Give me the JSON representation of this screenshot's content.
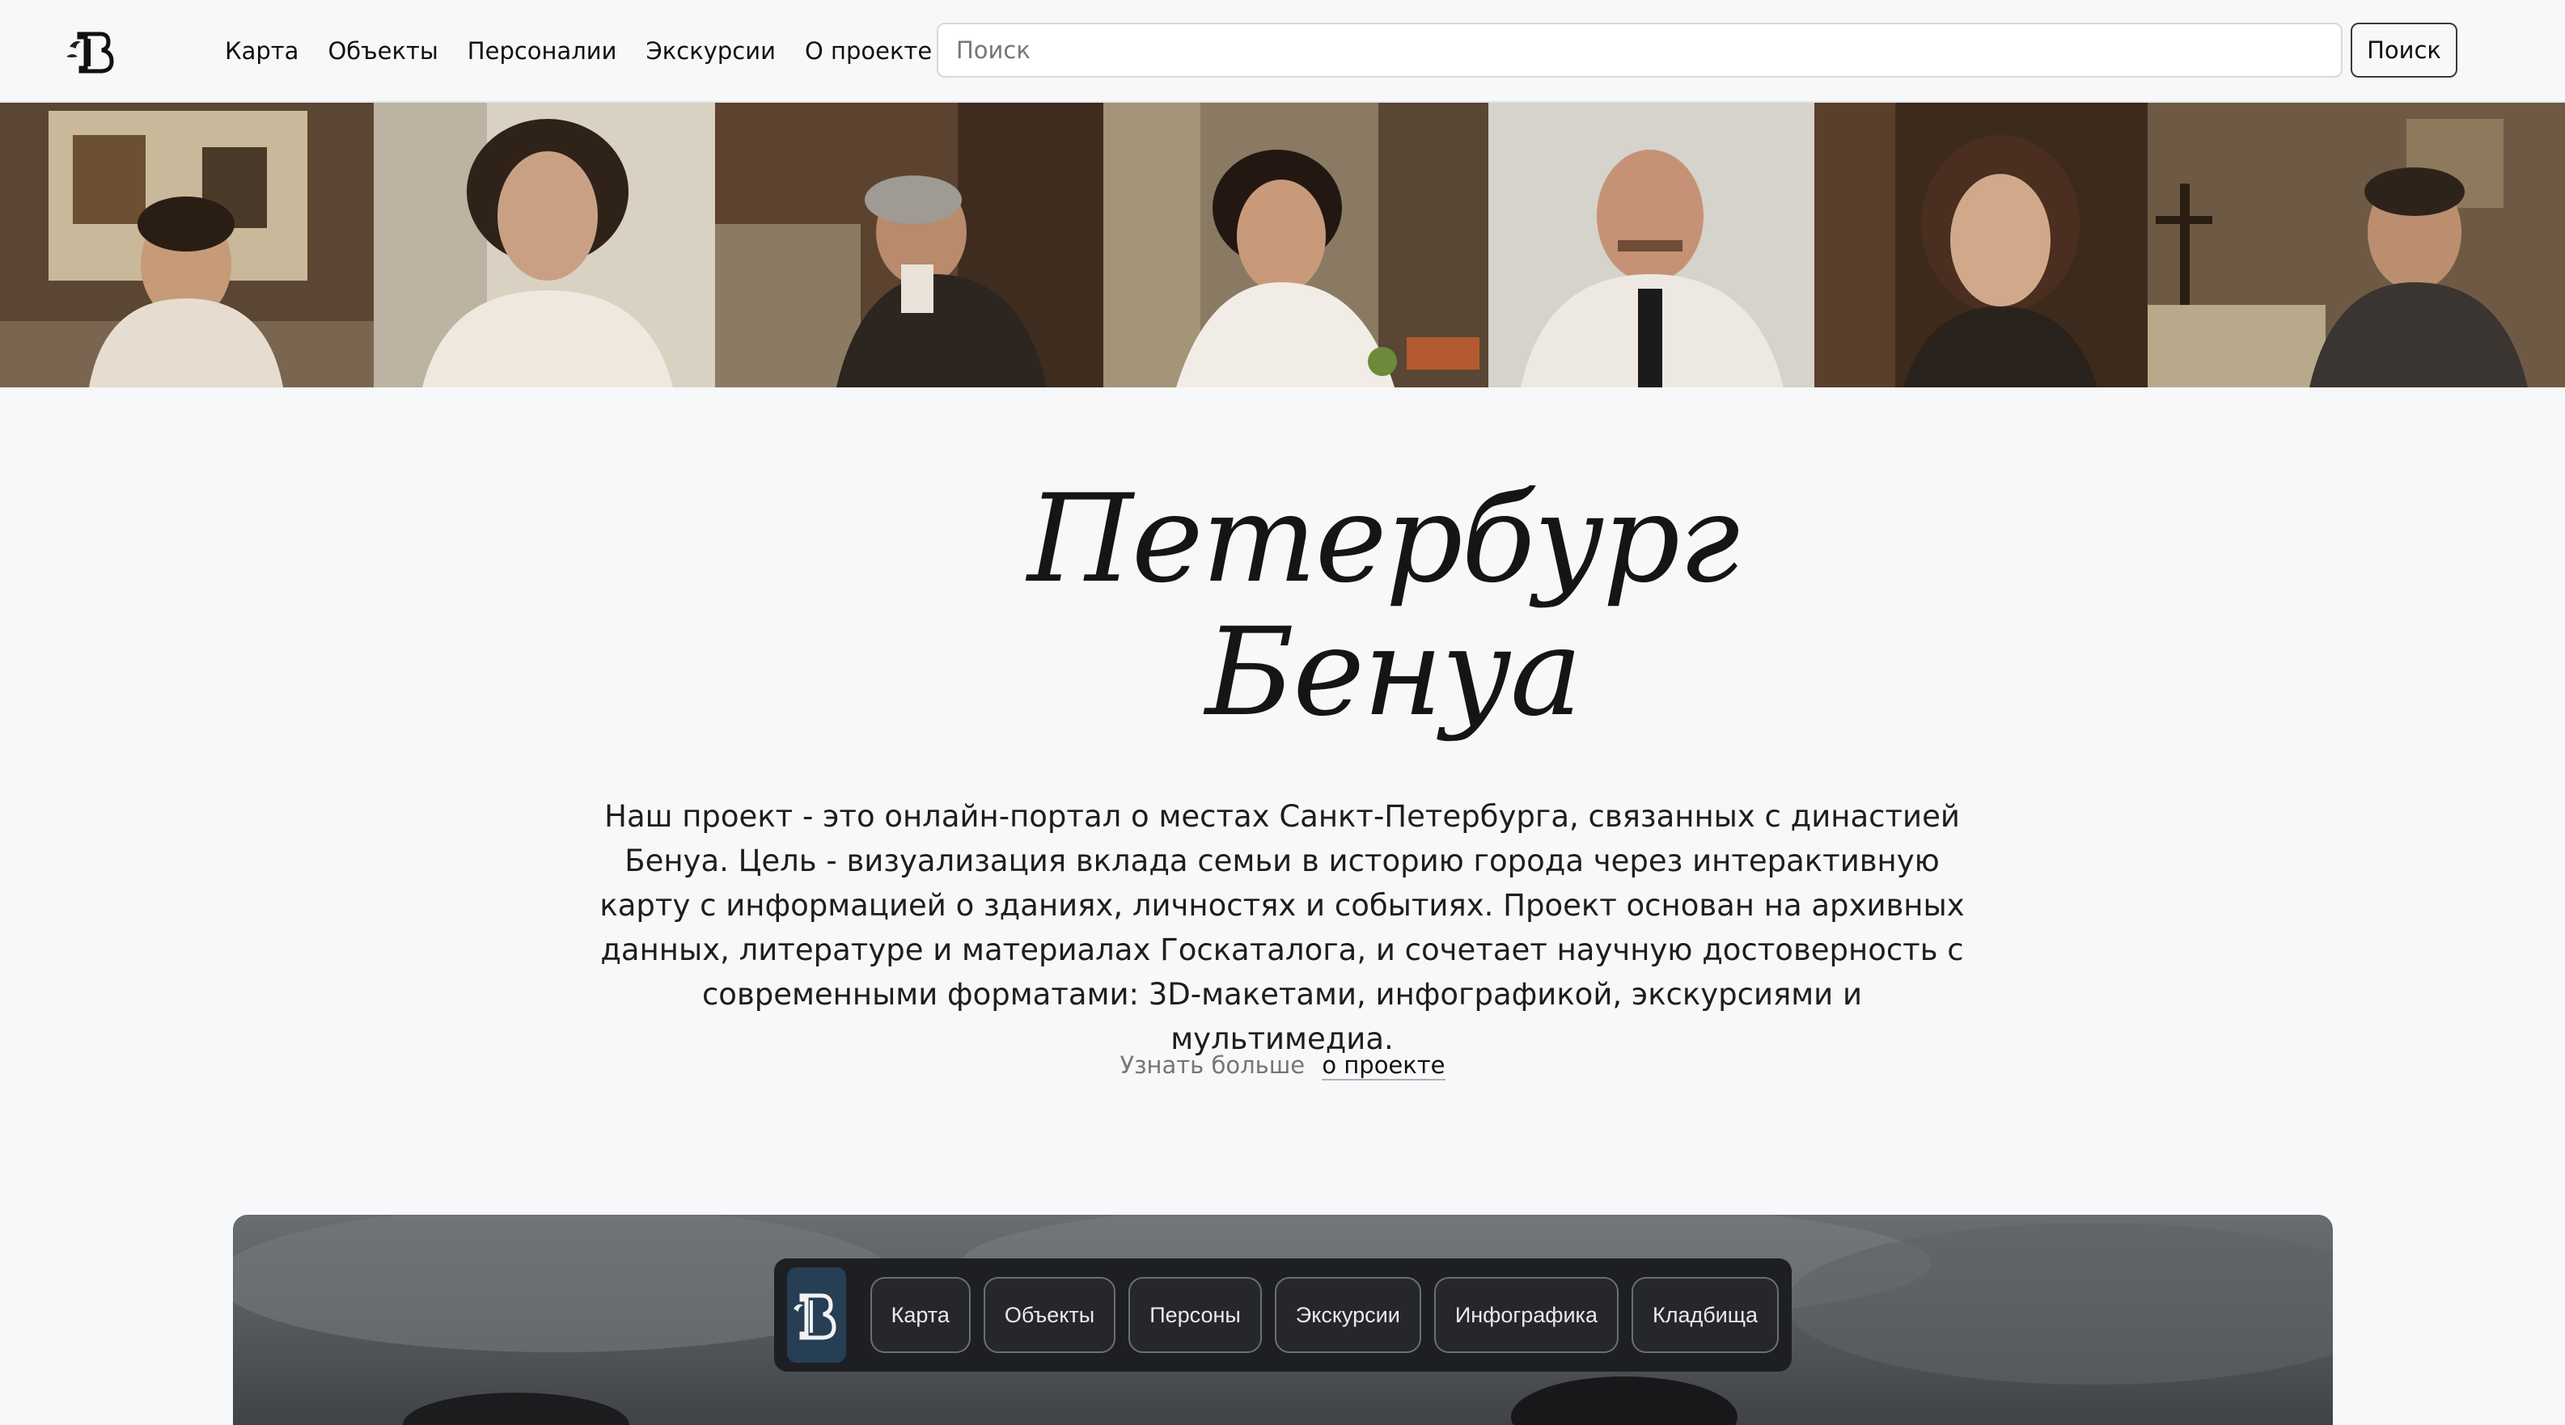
{
  "header": {
    "logo_icon": "benua-monogram-logo",
    "nav": [
      "Карта",
      "Объекты",
      "Персоналии",
      "Экскурсии",
      "О проекте"
    ],
    "search_placeholder": "Поиск",
    "search_button": "Поиск"
  },
  "banner": {
    "portraits": [
      "young-man-portrait",
      "curly-haired-woman-portrait",
      "bearded-man-reading-portrait",
      "woman-resting-head-portrait",
      "bald-man-portrait",
      "young-woman-portrait",
      "man-at-desk-portrait"
    ]
  },
  "hero": {
    "title_line1": "Петербург",
    "title_line2": "Бенуа",
    "description": "Наш проект - это онлайн-портал о местах Санкт-Петербурга, связанных с династией Бенуа. Цель - визуализация вклада семьи в историю города через интерактивную карту с информацией о зданиях, личностях и событиях. Проект основан на архивных данных, литературе и материалах Госкаталога, и сочетает научную достоверность с современными форматами: 3D-макетами, инфографикой, экскурсиями и мультимедиа.",
    "more_prefix": "Узнать больше",
    "more_link": "о проекте"
  },
  "feature_toolbar": {
    "logo_icon": "benua-monogram-logo",
    "buttons": [
      "Карта",
      "Объекты",
      "Персоны",
      "Экскурсии",
      "Инфографика",
      "Кладбища"
    ]
  },
  "colors": {
    "page_bg": "#f7f8fa",
    "toolbar_bg": "#1e1f22",
    "toolbar_logo_bg": "#263f55"
  }
}
